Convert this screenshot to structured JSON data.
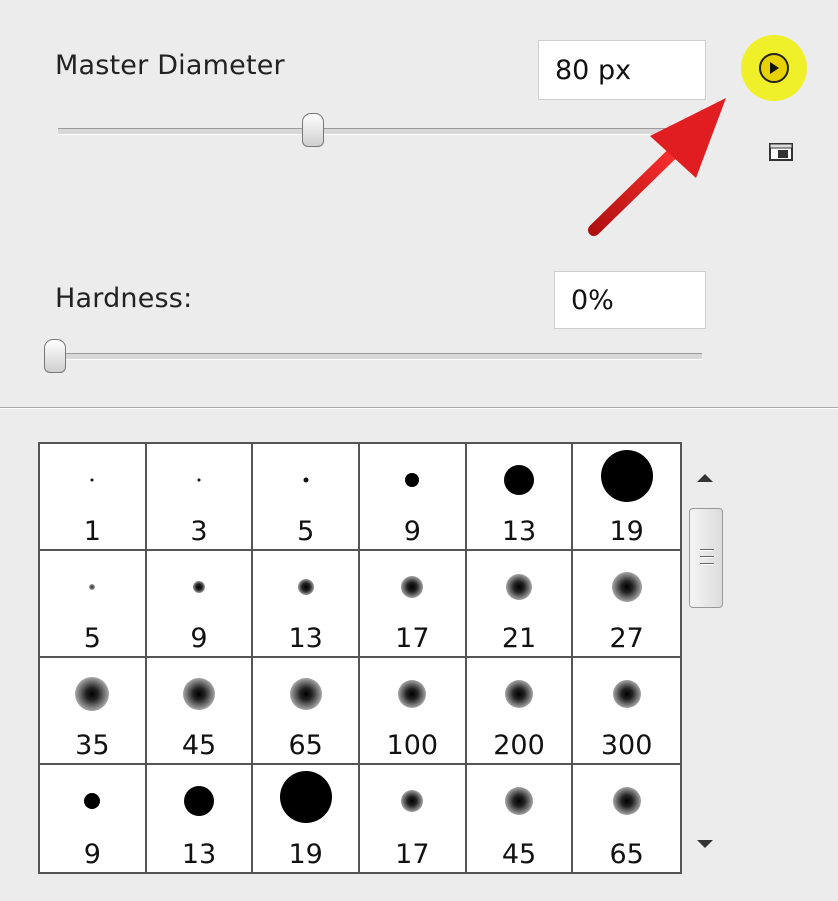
{
  "master_diameter": {
    "label": "Master Diameter",
    "value": "80 px"
  },
  "hardness": {
    "label": "Hardness:",
    "value": "0%"
  },
  "menu_button": {
    "icon": "play-triangle-icon",
    "highlight_color": "#f0f02a"
  },
  "annotation": {
    "arrow_color": "#d9191c"
  },
  "brush_presets": [
    {
      "size": "1"
    },
    {
      "size": "3"
    },
    {
      "size": "5"
    },
    {
      "size": "9"
    },
    {
      "size": "13"
    },
    {
      "size": "19"
    },
    {
      "size": "5"
    },
    {
      "size": "9"
    },
    {
      "size": "13"
    },
    {
      "size": "17"
    },
    {
      "size": "21"
    },
    {
      "size": "27"
    },
    {
      "size": "35"
    },
    {
      "size": "45"
    },
    {
      "size": "65"
    },
    {
      "size": "100"
    },
    {
      "size": "200"
    },
    {
      "size": "300"
    },
    {
      "size": "9"
    },
    {
      "size": "13"
    },
    {
      "size": "19"
    },
    {
      "size": "17"
    },
    {
      "size": "45"
    },
    {
      "size": "65"
    }
  ]
}
